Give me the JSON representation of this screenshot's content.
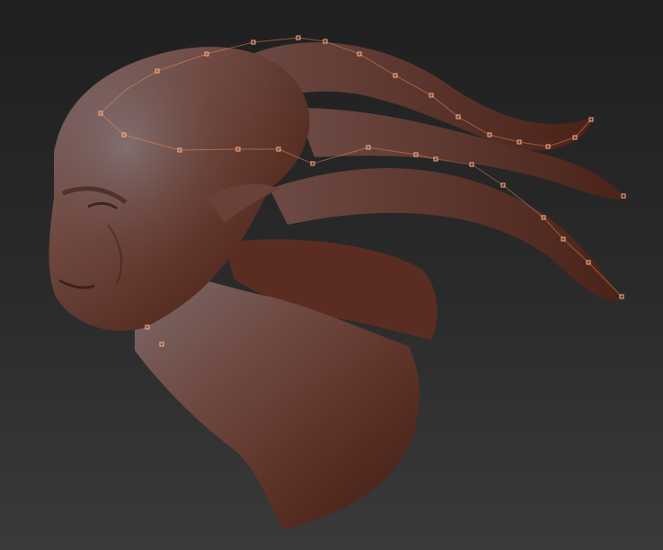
{
  "viewport": {
    "background": "#2a2a2a",
    "model_base_color": "#6b3a2b",
    "model_highlight_color": "#8c6a66",
    "curve_color": "#ff9a5a"
  },
  "model": {
    "subject": "",
    "curve_points_visible": true
  }
}
